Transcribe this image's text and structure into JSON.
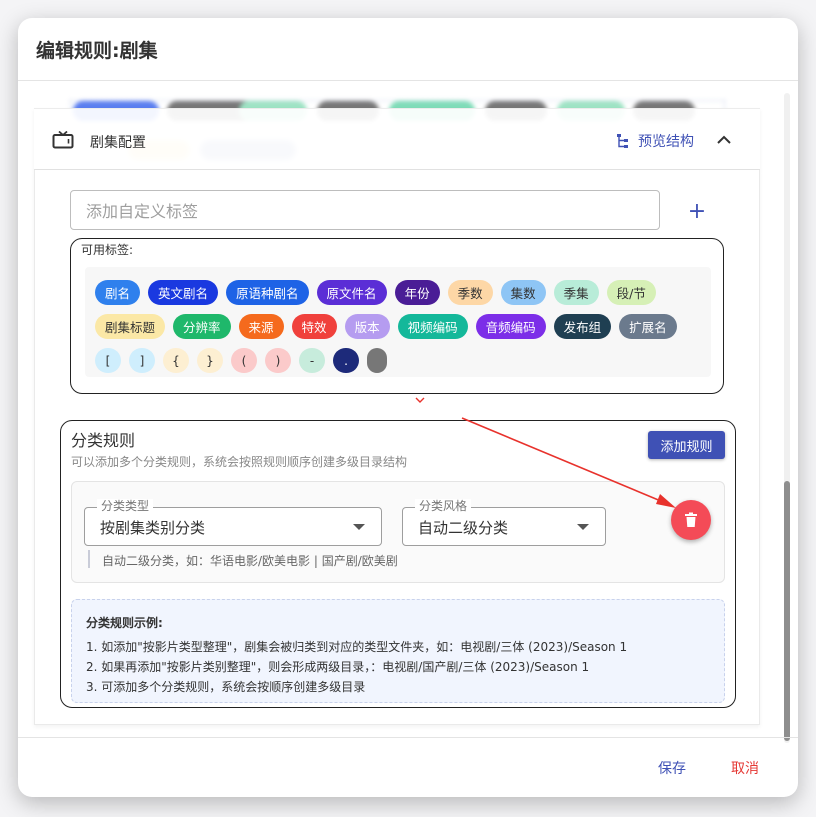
{
  "dialog": {
    "title": "编辑规则:剧集",
    "save_label": "保存",
    "cancel_label": "取消"
  },
  "config": {
    "title": "剧集配置",
    "preview_label": "预览结构",
    "icon": "tv-icon",
    "collapse_icon": "chevron-up-icon"
  },
  "custom_tag": {
    "placeholder": "添加自定义标签",
    "add_icon": "plus-icon"
  },
  "available_tags": {
    "label": "可用标签:",
    "rows": [
      [
        {
          "text": "剧名",
          "bg": "#2f80ed",
          "fg": "#ffffff"
        },
        {
          "text": "英文剧名",
          "bg": "#1a39e0",
          "fg": "#ffffff"
        },
        {
          "text": "原语种剧名",
          "bg": "#1e63e6",
          "fg": "#ffffff"
        },
        {
          "text": "原文件名",
          "bg": "#5b2ed6",
          "fg": "#ffffff"
        },
        {
          "text": "年份",
          "bg": "#4a1d96",
          "fg": "#ffffff"
        },
        {
          "text": "季数",
          "bg": "#fdd7a6",
          "fg": "#333333"
        },
        {
          "text": "集数",
          "bg": "#8ec5f5",
          "fg": "#333333"
        },
        {
          "text": "季集",
          "bg": "#b8ecd8",
          "fg": "#333333"
        },
        {
          "text": "段/节",
          "bg": "#d6f0b6",
          "fg": "#333333"
        }
      ],
      [
        {
          "text": "剧集标题",
          "bg": "#fbe8a6",
          "fg": "#333333"
        },
        {
          "text": "分辨率",
          "bg": "#1fb86b",
          "fg": "#ffffff"
        },
        {
          "text": "来源",
          "bg": "#f56a1d",
          "fg": "#ffffff"
        },
        {
          "text": "特效",
          "bg": "#f0413c",
          "fg": "#ffffff"
        },
        {
          "text": "版本",
          "bg": "#b59cf0",
          "fg": "#ffffff"
        },
        {
          "text": "视频编码",
          "bg": "#14b89a",
          "fg": "#ffffff"
        },
        {
          "text": "音频编码",
          "bg": "#7c2ee8",
          "fg": "#ffffff"
        },
        {
          "text": "发布组",
          "bg": "#1f3f52",
          "fg": "#ffffff"
        },
        {
          "text": "扩展名",
          "bg": "#6b7a8d",
          "fg": "#ffffff"
        }
      ]
    ],
    "brackets": [
      {
        "text": "[",
        "bg": "#cfeefd",
        "fg": "#333333"
      },
      {
        "text": "]",
        "bg": "#cfeefd",
        "fg": "#333333"
      },
      {
        "text": "{",
        "bg": "#fdefd2",
        "fg": "#333333"
      },
      {
        "text": "}",
        "bg": "#fdefd2",
        "fg": "#333333"
      },
      {
        "text": "(",
        "bg": "#fbcaca",
        "fg": "#333333"
      },
      {
        "text": ")",
        "bg": "#fbcaca",
        "fg": "#333333"
      },
      {
        "text": "-",
        "bg": "#c7ecdc",
        "fg": "#333333"
      },
      {
        "text": ".",
        "bg": "#1d2a7a",
        "fg": "#ffffff"
      },
      {
        "text": "",
        "bg": "#777777",
        "fg": "#ffffff"
      }
    ]
  },
  "classification": {
    "title": "分类规则",
    "subtitle": "可以添加多个分类规则，系统会按照规则顺序创建多级目录结构",
    "add_rule_label": "添加规则",
    "rule": {
      "type_label": "分类类型",
      "type_value": "按剧集类别分类",
      "style_label": "分类风格",
      "style_value": "自动二级分类",
      "hint": "自动二级分类，如：华语电影/欧美电影 | 国产剧/欧美剧",
      "delete_icon": "trash-icon"
    },
    "example": {
      "title": "分类规则示例:",
      "lines": [
        "1. 如添加\"按影片类型整理\"，剧集会被归类到对应的类型文件夹，如：电视剧/三体 (2023)/Season 1",
        "2. 如果再添加\"按影片类别整理\"，则会形成两级目录，：电视剧/国产剧/三体 (2023)/Season 1",
        "3. 可添加多个分类规则，系统会按顺序创建多级目录"
      ]
    }
  },
  "annotation_color": "#e8322c",
  "accent_color": "#3f51b5"
}
